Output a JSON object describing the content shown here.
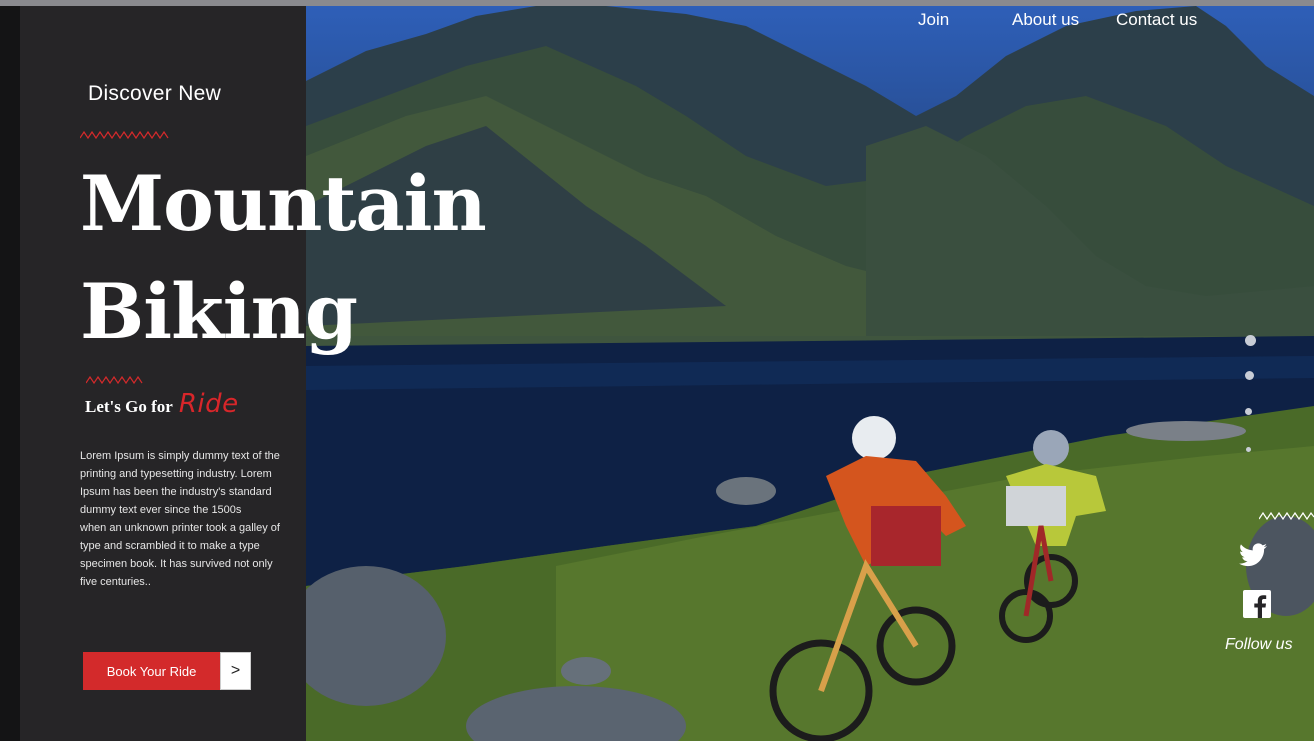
{
  "nav": {
    "items": [
      {
        "label": "Join"
      },
      {
        "label": "About us"
      },
      {
        "label": "Contact us"
      }
    ]
  },
  "hero": {
    "eyebrow": "Discover New",
    "title_line1": "Mountain",
    "title_line2": "Biking",
    "tagline_prefix": "Let's Go for",
    "tagline_accent": "Ride",
    "body_paragraph1": "Lorem Ipsum is simply dummy text of the printing and typesetting industry. Lorem Ipsum has been the industry's standard dummy text ever since the 1500s",
    "body_paragraph2": "when an unknown printer took a galley of type and scrambled it to make a type specimen book. It has survived not only five centuries..",
    "cta_label": "Book Your Ride",
    "cta_arrow": ">"
  },
  "slider": {
    "count": 4,
    "active_index": 0
  },
  "social": {
    "follow_label": "Follow us",
    "icons": [
      "twitter-icon",
      "facebook-icon"
    ]
  },
  "colors": {
    "accent": "#d32a2b",
    "panel": "#262527",
    "text": "#ffffff"
  }
}
